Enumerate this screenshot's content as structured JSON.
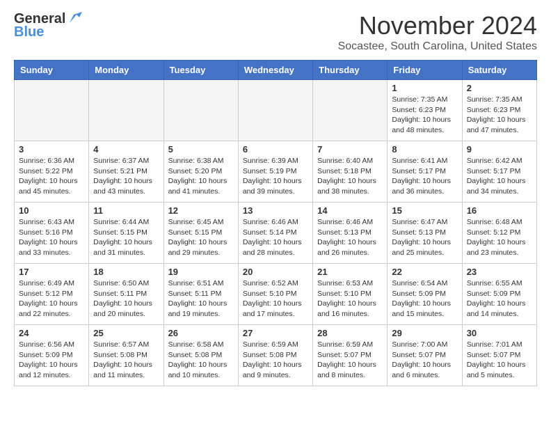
{
  "header": {
    "logo_general": "General",
    "logo_blue": "Blue",
    "month_title": "November 2024",
    "location": "Socastee, South Carolina, United States"
  },
  "days_of_week": [
    "Sunday",
    "Monday",
    "Tuesday",
    "Wednesday",
    "Thursday",
    "Friday",
    "Saturday"
  ],
  "weeks": [
    [
      {
        "day": "",
        "empty": true
      },
      {
        "day": "",
        "empty": true
      },
      {
        "day": "",
        "empty": true
      },
      {
        "day": "",
        "empty": true
      },
      {
        "day": "",
        "empty": true
      },
      {
        "day": "1",
        "sunrise": "7:35 AM",
        "sunset": "6:23 PM",
        "daylight": "10 hours and 48 minutes."
      },
      {
        "day": "2",
        "sunrise": "7:35 AM",
        "sunset": "6:23 PM",
        "daylight": "10 hours and 47 minutes."
      }
    ],
    [
      {
        "day": "3",
        "sunrise": "6:36 AM",
        "sunset": "5:22 PM",
        "daylight": "10 hours and 45 minutes."
      },
      {
        "day": "4",
        "sunrise": "6:37 AM",
        "sunset": "5:21 PM",
        "daylight": "10 hours and 43 minutes."
      },
      {
        "day": "5",
        "sunrise": "6:38 AM",
        "sunset": "5:20 PM",
        "daylight": "10 hours and 41 minutes."
      },
      {
        "day": "6",
        "sunrise": "6:39 AM",
        "sunset": "5:19 PM",
        "daylight": "10 hours and 39 minutes."
      },
      {
        "day": "7",
        "sunrise": "6:40 AM",
        "sunset": "5:18 PM",
        "daylight": "10 hours and 38 minutes."
      },
      {
        "day": "8",
        "sunrise": "6:41 AM",
        "sunset": "5:17 PM",
        "daylight": "10 hours and 36 minutes."
      },
      {
        "day": "9",
        "sunrise": "6:42 AM",
        "sunset": "5:17 PM",
        "daylight": "10 hours and 34 minutes."
      }
    ],
    [
      {
        "day": "10",
        "sunrise": "6:43 AM",
        "sunset": "5:16 PM",
        "daylight": "10 hours and 33 minutes."
      },
      {
        "day": "11",
        "sunrise": "6:44 AM",
        "sunset": "5:15 PM",
        "daylight": "10 hours and 31 minutes."
      },
      {
        "day": "12",
        "sunrise": "6:45 AM",
        "sunset": "5:15 PM",
        "daylight": "10 hours and 29 minutes."
      },
      {
        "day": "13",
        "sunrise": "6:46 AM",
        "sunset": "5:14 PM",
        "daylight": "10 hours and 28 minutes."
      },
      {
        "day": "14",
        "sunrise": "6:46 AM",
        "sunset": "5:13 PM",
        "daylight": "10 hours and 26 minutes."
      },
      {
        "day": "15",
        "sunrise": "6:47 AM",
        "sunset": "5:13 PM",
        "daylight": "10 hours and 25 minutes."
      },
      {
        "day": "16",
        "sunrise": "6:48 AM",
        "sunset": "5:12 PM",
        "daylight": "10 hours and 23 minutes."
      }
    ],
    [
      {
        "day": "17",
        "sunrise": "6:49 AM",
        "sunset": "5:12 PM",
        "daylight": "10 hours and 22 minutes."
      },
      {
        "day": "18",
        "sunrise": "6:50 AM",
        "sunset": "5:11 PM",
        "daylight": "10 hours and 20 minutes."
      },
      {
        "day": "19",
        "sunrise": "6:51 AM",
        "sunset": "5:11 PM",
        "daylight": "10 hours and 19 minutes."
      },
      {
        "day": "20",
        "sunrise": "6:52 AM",
        "sunset": "5:10 PM",
        "daylight": "10 hours and 17 minutes."
      },
      {
        "day": "21",
        "sunrise": "6:53 AM",
        "sunset": "5:10 PM",
        "daylight": "10 hours and 16 minutes."
      },
      {
        "day": "22",
        "sunrise": "6:54 AM",
        "sunset": "5:09 PM",
        "daylight": "10 hours and 15 minutes."
      },
      {
        "day": "23",
        "sunrise": "6:55 AM",
        "sunset": "5:09 PM",
        "daylight": "10 hours and 14 minutes."
      }
    ],
    [
      {
        "day": "24",
        "sunrise": "6:56 AM",
        "sunset": "5:09 PM",
        "daylight": "10 hours and 12 minutes."
      },
      {
        "day": "25",
        "sunrise": "6:57 AM",
        "sunset": "5:08 PM",
        "daylight": "10 hours and 11 minutes."
      },
      {
        "day": "26",
        "sunrise": "6:58 AM",
        "sunset": "5:08 PM",
        "daylight": "10 hours and 10 minutes."
      },
      {
        "day": "27",
        "sunrise": "6:59 AM",
        "sunset": "5:08 PM",
        "daylight": "10 hours and 9 minutes."
      },
      {
        "day": "28",
        "sunrise": "6:59 AM",
        "sunset": "5:07 PM",
        "daylight": "10 hours and 8 minutes."
      },
      {
        "day": "29",
        "sunrise": "7:00 AM",
        "sunset": "5:07 PM",
        "daylight": "10 hours and 6 minutes."
      },
      {
        "day": "30",
        "sunrise": "7:01 AM",
        "sunset": "5:07 PM",
        "daylight": "10 hours and 5 minutes."
      }
    ]
  ]
}
